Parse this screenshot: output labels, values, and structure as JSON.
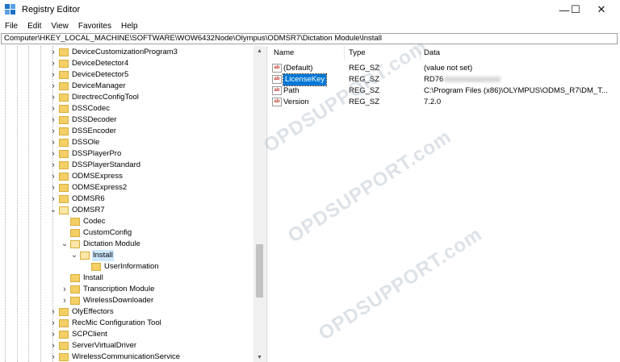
{
  "window": {
    "title": "Registry Editor",
    "minimize": "—",
    "maximize": "☐",
    "close": "✕"
  },
  "menu": [
    "File",
    "Edit",
    "View",
    "Favorites",
    "Help"
  ],
  "address": "Computer\\HKEY_LOCAL_MACHINE\\SOFTWARE\\WOW6432Node\\Olympus\\ODMSR7\\Dictation Module\\Install",
  "tree": [
    {
      "label": "DeviceCustomizationProgram3",
      "level": 0,
      "expander": "closed"
    },
    {
      "label": "DeviceDetector4",
      "level": 0,
      "expander": "closed"
    },
    {
      "label": "DeviceDetector5",
      "level": 0,
      "expander": "closed"
    },
    {
      "label": "DeviceManager",
      "level": 0,
      "expander": "closed"
    },
    {
      "label": "DirectrecConfigTool",
      "level": 0,
      "expander": "closed"
    },
    {
      "label": "DSSCodec",
      "level": 0,
      "expander": "closed"
    },
    {
      "label": "DSSDecoder",
      "level": 0,
      "expander": "closed"
    },
    {
      "label": "DSSEncoder",
      "level": 0,
      "expander": "closed"
    },
    {
      "label": "DSSOle",
      "level": 0,
      "expander": "closed"
    },
    {
      "label": "DSSPlayerPro",
      "level": 0,
      "expander": "closed"
    },
    {
      "label": "DSSPlayerStandard",
      "level": 0,
      "expander": "closed"
    },
    {
      "label": "ODMSExpress",
      "level": 0,
      "expander": "closed"
    },
    {
      "label": "ODMSExpress2",
      "level": 0,
      "expander": "closed"
    },
    {
      "label": "ODMSR6",
      "level": 0,
      "expander": "closed"
    },
    {
      "label": "ODMSR7",
      "level": 0,
      "expander": "open"
    },
    {
      "label": "Codec",
      "level": 1,
      "expander": "none"
    },
    {
      "label": "CustomConfig",
      "level": 1,
      "expander": "none"
    },
    {
      "label": "Dictation Module",
      "level": 1,
      "expander": "open"
    },
    {
      "label": "Install",
      "level": 2,
      "expander": "open",
      "selected": true
    },
    {
      "label": "UserInformation",
      "level": 3,
      "expander": "none"
    },
    {
      "label": "Install",
      "level": 1,
      "expander": "none"
    },
    {
      "label": "Transcription Module",
      "level": 1,
      "expander": "closed"
    },
    {
      "label": "WirelessDownloader",
      "level": 1,
      "expander": "closed"
    },
    {
      "label": "OlyEffectors",
      "level": 0,
      "expander": "closed"
    },
    {
      "label": "RecMic Configuration Tool",
      "level": 0,
      "expander": "closed"
    },
    {
      "label": "SCPClient",
      "level": 0,
      "expander": "closed"
    },
    {
      "label": "ServerVirtualDriver",
      "level": 0,
      "expander": "closed"
    },
    {
      "label": "WirelessCommunicationService",
      "level": 0,
      "expander": "closed"
    }
  ],
  "columns": {
    "name": "Name",
    "type": "Type",
    "data": "Data"
  },
  "values": [
    {
      "name": "(Default)",
      "type": "REG_SZ",
      "data": "(value not set)",
      "selected": false
    },
    {
      "name": "LicenseKey",
      "type": "REG_SZ",
      "data": "RD76",
      "selected": true
    },
    {
      "name": "Path",
      "type": "REG_SZ",
      "data": "C:\\Program Files (x86)\\OLYMPUS\\ODMS_R7\\DM_T...",
      "selected": false
    },
    {
      "name": "Version",
      "type": "REG_SZ",
      "data": "7.2.0",
      "selected": false
    }
  ],
  "value_icon_text": "ab",
  "watermark": "OPDSUPPORT.com"
}
